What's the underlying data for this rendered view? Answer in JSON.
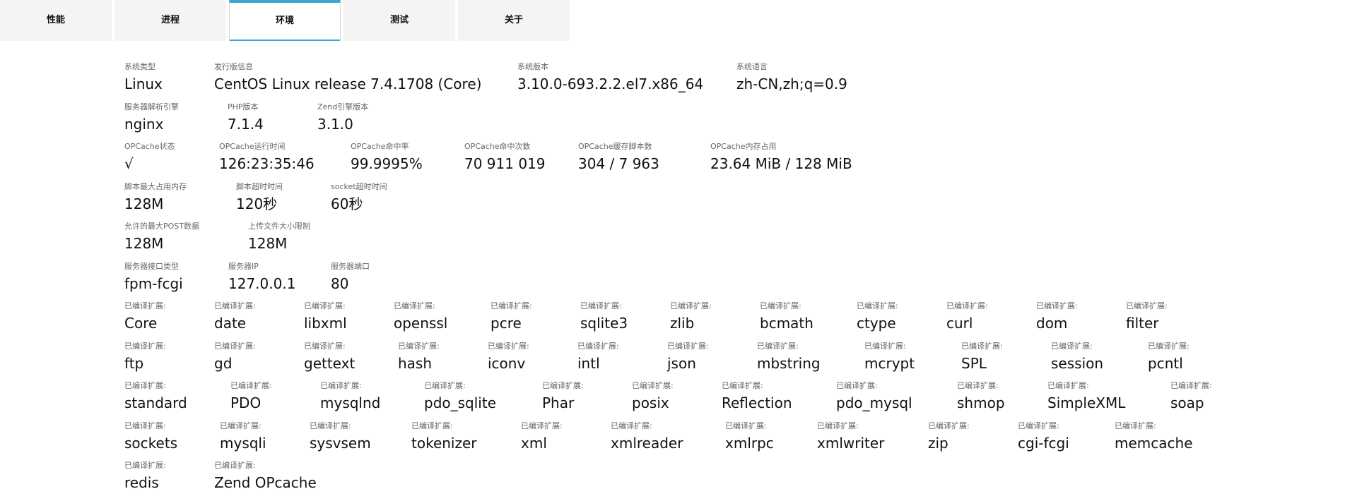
{
  "tabs": [
    "性能",
    "进程",
    "环境",
    "测试",
    "关于"
  ],
  "active_tab": 2,
  "rows": [
    [
      {
        "label": "系统类型",
        "value": "Linux"
      },
      {
        "label": "发行版信息",
        "value": "CentOS Linux release 7.4.1708 (Core)"
      },
      {
        "label": "系统版本",
        "value": "3.10.0-693.2.2.el7.x86_64"
      },
      {
        "label": "系统语言",
        "value": "zh-CN,zh;q=0.9"
      }
    ],
    [
      {
        "label": "服务器解析引擎",
        "value": "nginx"
      },
      {
        "label": "PHP版本",
        "value": "7.1.4"
      },
      {
        "label": "Zend引擎版本",
        "value": "3.1.0"
      }
    ],
    [
      {
        "label": "OPCache状态",
        "value": "√"
      },
      {
        "label": "OPCache运行时间",
        "value": "126:23:35:46"
      },
      {
        "label": "OPCache命中率",
        "value": "99.9995%"
      },
      {
        "label": "OPCache命中次数",
        "value": "70 911 019"
      },
      {
        "label": "OPCache缓存脚本数",
        "value": "304  /  7 963"
      },
      {
        "label": "OPCache内存占用",
        "value": "23.64 MiB  /  128 MiB"
      }
    ],
    [
      {
        "label": "脚本最大占用内存",
        "value": "128M"
      },
      {
        "label": "脚本超时时间",
        "value": "120秒"
      },
      {
        "label": "socket超时时间",
        "value": "60秒"
      }
    ],
    [
      {
        "label": "允许的最大POST数据",
        "value": "128M"
      },
      {
        "label": "上传文件大小限制",
        "value": "128M"
      }
    ],
    [
      {
        "label": "服务器接口类型",
        "value": "fpm-fcgi"
      },
      {
        "label": "服务器IP",
        "value": "127.0.0.1"
      },
      {
        "label": "服务器端口",
        "value": "80"
      }
    ]
  ],
  "extension_label": "已编译扩展:",
  "extension_rows": [
    [
      "Core",
      "date",
      "libxml",
      "openssl",
      "pcre",
      "sqlite3",
      "zlib",
      "bcmath",
      "ctype",
      "curl",
      "dom",
      "filter"
    ],
    [
      "ftp",
      "gd",
      "gettext",
      "hash",
      "iconv",
      "intl",
      "json",
      "mbstring",
      "mcrypt",
      "SPL",
      "session",
      "pcntl"
    ],
    [
      "standard",
      "PDO",
      "mysqlnd",
      "pdo_sqlite",
      "Phar",
      "posix",
      "Reflection",
      "pdo_mysql",
      "shmop",
      "SimpleXML",
      "soap"
    ],
    [
      "sockets",
      "mysqli",
      "sysvsem",
      "tokenizer",
      "xml",
      "xmlreader",
      "xmlrpc",
      "xmlwriter",
      "zip",
      "cgi-fcgi",
      "memcache"
    ],
    [
      "redis",
      "Zend OPcache"
    ]
  ],
  "colors": {
    "accent": "#3aa7d0",
    "tab_bg": "#f4f4f4",
    "label": "#666666",
    "value": "#111111"
  }
}
